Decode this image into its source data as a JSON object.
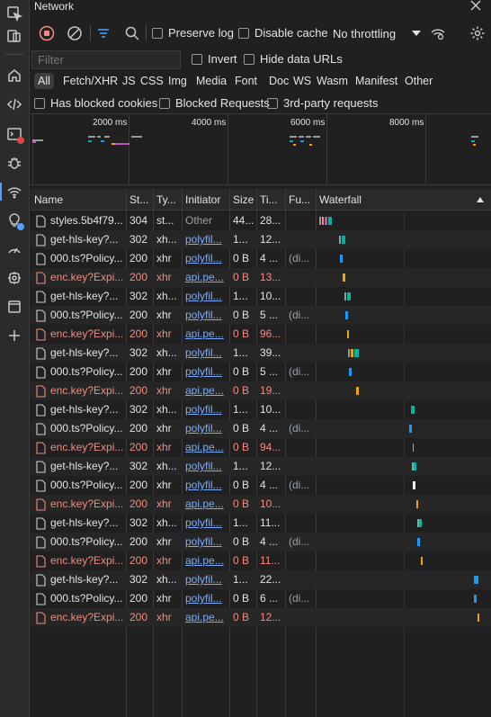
{
  "panel": {
    "title": "Network"
  },
  "toolbar": {
    "preserve_log": "Preserve log",
    "disable_cache": "Disable cache",
    "throttling": "No throttling"
  },
  "filter": {
    "placeholder": "Filter",
    "invert": "Invert",
    "hide_data_urls": "Hide data URLs"
  },
  "types": [
    "All",
    "Fetch/XHR",
    "JS",
    "CSS",
    "Img",
    "Media",
    "Font",
    "Doc",
    "WS",
    "Wasm",
    "Manifest",
    "Other"
  ],
  "blocked": {
    "has_blocked_cookies": "Has blocked cookies",
    "blocked_requests": "Blocked Requests",
    "third_party": "3rd-party requests"
  },
  "overview": {
    "ticks": [
      "2000 ms",
      "4000 ms",
      "6000 ms",
      "8000 ms"
    ]
  },
  "columns": {
    "name": "Name",
    "status": "St...",
    "type": "Ty...",
    "initiator": "Initiator",
    "size": "Size",
    "time": "Ti...",
    "fulfilled": "Fu...",
    "waterfall": "Waterfall"
  },
  "rows": [
    {
      "name": "styles.5b4f79...",
      "status": "304",
      "type": "st...",
      "initiator": "Other",
      "size": "44...",
      "time": "28...",
      "fu": "",
      "err": false,
      "link": false
    },
    {
      "name": "get-hls-key?...",
      "status": "302",
      "type": "xh...",
      "initiator": "polyfil...",
      "size": "1...",
      "time": "12...",
      "fu": "",
      "err": false,
      "link": true
    },
    {
      "name": "000.ts?Policy...",
      "status": "200",
      "type": "xhr",
      "initiator": "polyfil...",
      "size": "0 B",
      "time": "4 ...",
      "fu": "(di...",
      "err": false,
      "link": true
    },
    {
      "name": "enc.key?Expi...",
      "status": "200",
      "type": "xhr",
      "initiator": "api.pe...",
      "size": "0 B",
      "time": "13...",
      "fu": "",
      "err": true,
      "link": true
    },
    {
      "name": "get-hls-key?...",
      "status": "302",
      "type": "xh...",
      "initiator": "polyfil...",
      "size": "1...",
      "time": "10...",
      "fu": "",
      "err": false,
      "link": true
    },
    {
      "name": "000.ts?Policy...",
      "status": "200",
      "type": "xhr",
      "initiator": "polyfil...",
      "size": "0 B",
      "time": "5 ...",
      "fu": "(di...",
      "err": false,
      "link": true
    },
    {
      "name": "enc.key?Expi...",
      "status": "200",
      "type": "xhr",
      "initiator": "api.pe...",
      "size": "0 B",
      "time": "96...",
      "fu": "",
      "err": true,
      "link": true
    },
    {
      "name": "get-hls-key?...",
      "status": "302",
      "type": "xh...",
      "initiator": "polyfil...",
      "size": "1...",
      "time": "39...",
      "fu": "",
      "err": false,
      "link": true
    },
    {
      "name": "000.ts?Policy...",
      "status": "200",
      "type": "xhr",
      "initiator": "polyfil...",
      "size": "0 B",
      "time": "5 ...",
      "fu": "(di...",
      "err": false,
      "link": true
    },
    {
      "name": "enc.key?Expi...",
      "status": "200",
      "type": "xhr",
      "initiator": "api.pe...",
      "size": "0 B",
      "time": "19...",
      "fu": "",
      "err": true,
      "link": true
    },
    {
      "name": "get-hls-key?...",
      "status": "302",
      "type": "xh...",
      "initiator": "polyfil...",
      "size": "1...",
      "time": "10...",
      "fu": "",
      "err": false,
      "link": true
    },
    {
      "name": "000.ts?Policy...",
      "status": "200",
      "type": "xhr",
      "initiator": "polyfil...",
      "size": "0 B",
      "time": "4 ...",
      "fu": "(di...",
      "err": false,
      "link": true
    },
    {
      "name": "enc.key?Expi...",
      "status": "200",
      "type": "xhr",
      "initiator": "api.pe...",
      "size": "0 B",
      "time": "94...",
      "fu": "",
      "err": true,
      "link": true
    },
    {
      "name": "get-hls-key?...",
      "status": "302",
      "type": "xh...",
      "initiator": "polyfil...",
      "size": "1...",
      "time": "12...",
      "fu": "",
      "err": false,
      "link": true
    },
    {
      "name": "000.ts?Policy...",
      "status": "200",
      "type": "xhr",
      "initiator": "polyfil...",
      "size": "0 B",
      "time": "4 ...",
      "fu": "(di...",
      "err": false,
      "link": true
    },
    {
      "name": "enc.key?Expi...",
      "status": "200",
      "type": "xhr",
      "initiator": "api.pe...",
      "size": "0 B",
      "time": "10...",
      "fu": "",
      "err": true,
      "link": true
    },
    {
      "name": "get-hls-key?...",
      "status": "302",
      "type": "xh...",
      "initiator": "polyfil...",
      "size": "1...",
      "time": "11...",
      "fu": "",
      "err": false,
      "link": true
    },
    {
      "name": "000.ts?Policy...",
      "status": "200",
      "type": "xhr",
      "initiator": "polyfil...",
      "size": "0 B",
      "time": "4 ...",
      "fu": "(di...",
      "err": false,
      "link": true
    },
    {
      "name": "enc.key?Expi...",
      "status": "200",
      "type": "xhr",
      "initiator": "api.pe...",
      "size": "0 B",
      "time": "11...",
      "fu": "",
      "err": true,
      "link": true
    },
    {
      "name": "get-hls-key?...",
      "status": "302",
      "type": "xh...",
      "initiator": "polyfil...",
      "size": "1...",
      "time": "22...",
      "fu": "",
      "err": false,
      "link": true
    },
    {
      "name": "000.ts?Policy...",
      "status": "200",
      "type": "xhr",
      "initiator": "polyfil...",
      "size": "0 B",
      "time": "6 ...",
      "fu": "(di...",
      "err": false,
      "link": true
    },
    {
      "name": "enc.key?Expi...",
      "status": "200",
      "type": "xhr",
      "initiator": "api.pe...",
      "size": "0 B",
      "time": "12...",
      "fu": "",
      "err": true,
      "link": true
    }
  ],
  "colors": {
    "accent": "#4fa3ff",
    "record": "#f28b82",
    "error_text": "#f28b82",
    "link": "#7cacf8",
    "waterfall_teal": "#00b4a0",
    "waterfall_blue": "#1a9af7",
    "waterfall_orange": "#e8a317"
  },
  "activity_icons": [
    "inspect-icon",
    "device-toolbar-icon",
    "welcome-icon",
    "elements-icon",
    "console-icon",
    "sources-icon",
    "network-icon",
    "issues-icon",
    "performance-icon",
    "settings-gear-icon",
    "application-icon",
    "more-tools-icon"
  ]
}
